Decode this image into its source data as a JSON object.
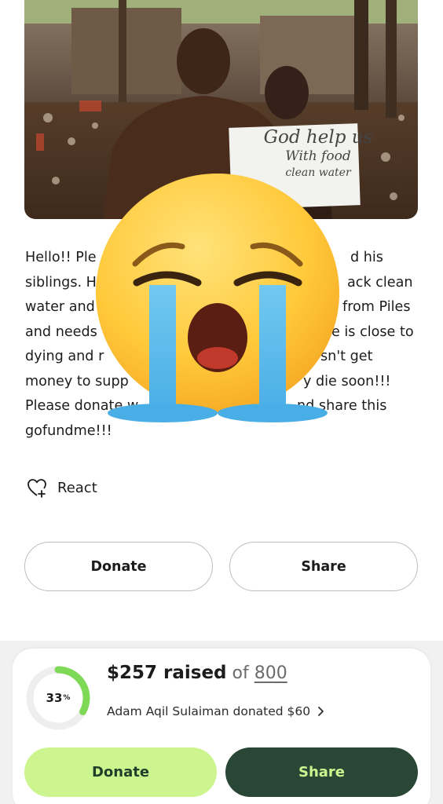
{
  "photo": {
    "sign_line1": "God help us",
    "sign_line2": "With food",
    "sign_line3": "clean water"
  },
  "story": {
    "lines": [
      "Hello!! Ple",
      "d his",
      "siblings. H",
      "ack clean",
      "water and",
      "from Piles",
      "and needs",
      "e is close to",
      "dying and r",
      "sn't get",
      "money to supp",
      "y die soon!!!",
      "Please donate w",
      "nd share this",
      "gofundme!!!"
    ]
  },
  "emoji": {
    "icon": "loudly-crying-face-emoji"
  },
  "react": {
    "label": "React",
    "icon": "heart-plus-icon"
  },
  "actions": {
    "donate_label": "Donate",
    "share_label": "Share"
  },
  "progress": {
    "percent_value": 33,
    "percent_number": "33",
    "percent_sign": "%",
    "raised_amount": "$257 raised",
    "of_text": "of",
    "goal": "800",
    "recent_donation": "Adam Aqil Sulaiman donated $60",
    "chevron_icon": "chevron-right-icon"
  },
  "bottom_bar": {
    "donate_label": "Donate",
    "share_label": "Share"
  },
  "colors": {
    "accent_green_light": "#cdf58f",
    "accent_green_dark": "#2a4634",
    "ring_track": "#eeeeee",
    "ring_fill": "#7ed957"
  }
}
